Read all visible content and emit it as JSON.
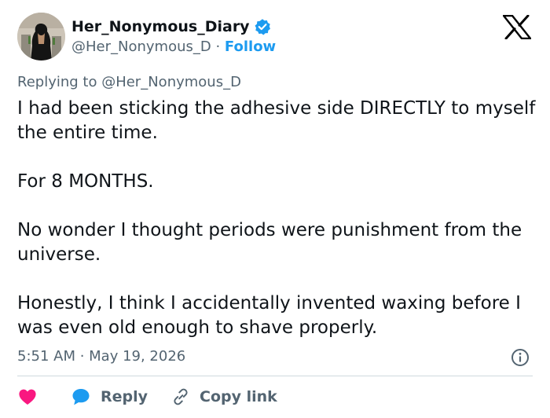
{
  "author": {
    "display_name": "Her_Nonymous_Diary",
    "handle": "@Her_Nonymous_D",
    "separator": " · ",
    "follow_label": "Follow",
    "verified": true
  },
  "reply_context": "Replying to @Her_Nonymous_D",
  "tweet": {
    "paragraphs": [
      "I had been sticking the adhesive side DIRECTLY to myself the entire time.",
      "For 8 MONTHS.",
      "No wonder I thought periods were punishment from the universe.",
      "Honestly, I think I accidentally invented waxing before I was even old enough to shave properly."
    ],
    "timestamp": "5:51 AM · May 19, 2026"
  },
  "actions": {
    "like_icon": "heart-icon",
    "reply_label": "Reply",
    "copy_label": "Copy link"
  },
  "colors": {
    "text": "#0f1419",
    "secondary": "#536471",
    "accent": "#1d9bf0",
    "heart": "#f91880",
    "divider": "#cfd9de"
  }
}
